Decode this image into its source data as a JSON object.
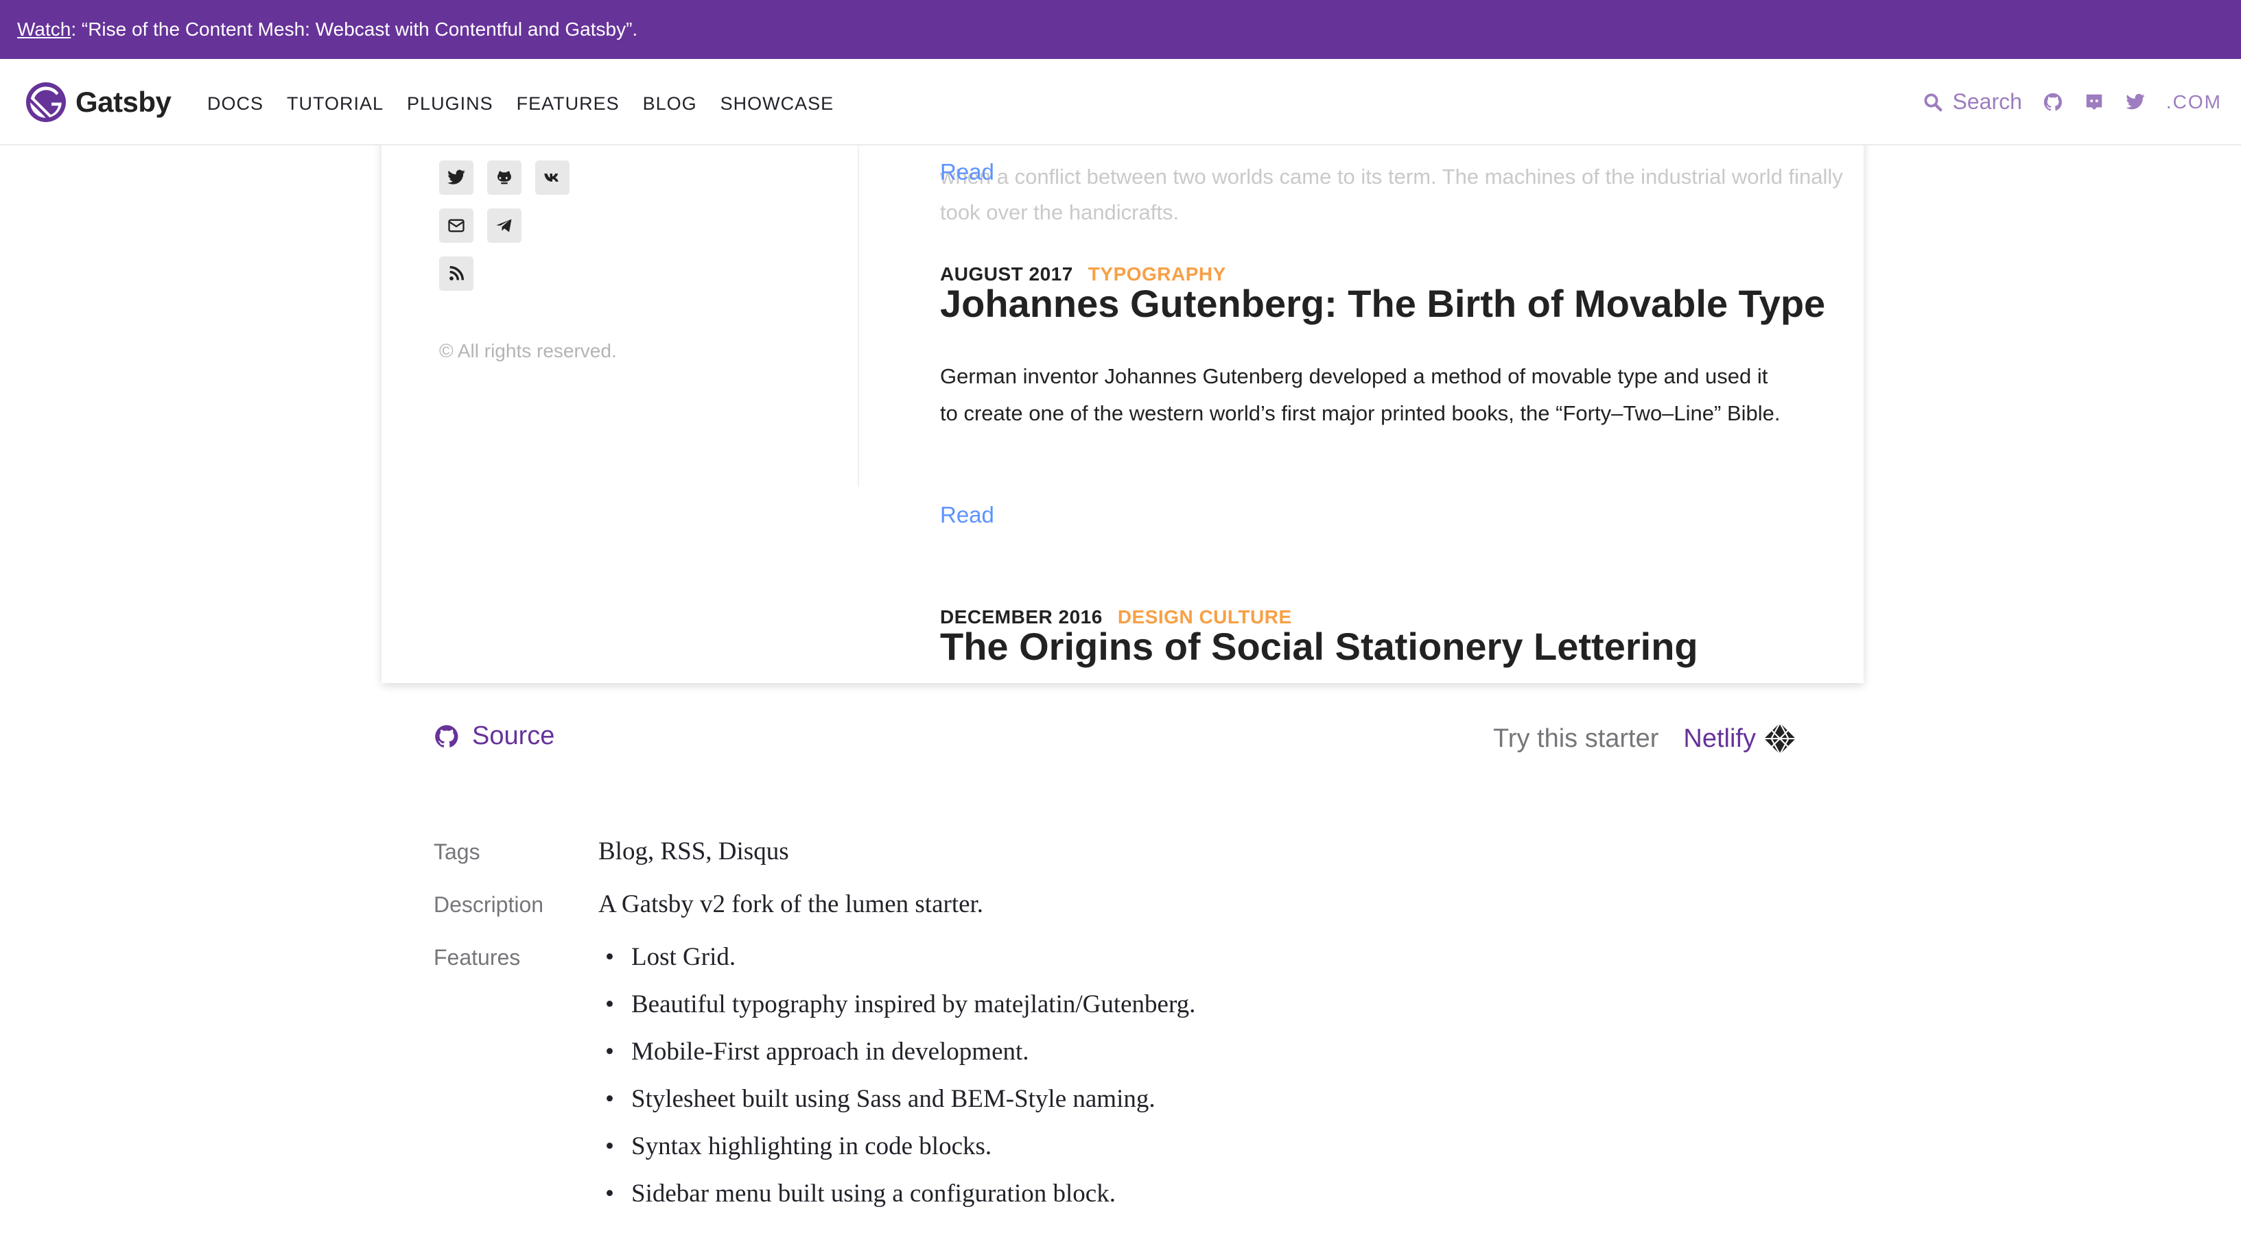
{
  "banner": {
    "link": "Watch",
    "text": ": “Rise of the Content Mesh: Webcast with Contentful and Gatsby”."
  },
  "header": {
    "brand": "Gatsby",
    "nav": [
      "DOCS",
      "TUTORIAL",
      "PLUGINS",
      "FEATURES",
      "BLOG",
      "SHOWCASE"
    ],
    "search_placeholder": "Search",
    "dotcom": ".COM"
  },
  "preview": {
    "faded_text": "when a conflict between two worlds came to its term. The machines of the industrial world finally took over the handicrafts.",
    "copyright": "© All rights reserved.",
    "read_label": "Read",
    "posts": [
      {
        "date": "AUGUST 2017",
        "category": "TYPOGRAPHY",
        "title": "Johannes Gutenberg: The Birth of Movable Type",
        "description": "German inventor Johannes Gutenberg developed a method of movable type and used it to create one of the western world’s first major printed books, the “Forty–Two–Line” Bible."
      },
      {
        "date": "DECEMBER 2016",
        "category": "DESIGN CULTURE",
        "title": "The Origins of Social Stationery Lettering"
      }
    ]
  },
  "source": {
    "label": "Source"
  },
  "try": {
    "label": "Try this starter",
    "netlify": "Netlify"
  },
  "details": {
    "tags_label": "Tags",
    "tags_value": "Blog, RSS, Disqus",
    "description_label": "Description",
    "description_value": "A Gatsby v2 fork of the lumen starter.",
    "features_label": "Features",
    "features": [
      "Lost Grid.",
      "Beautiful typography inspired by matejlatin/Gutenberg.",
      "Mobile-First approach in development.",
      "Stylesheet built using Sass and BEM-Style naming.",
      "Syntax highlighting in code blocks.",
      "Sidebar menu built using a configuration block."
    ]
  },
  "colors": {
    "brand": "#663399",
    "accent": "#f7a046",
    "link": "#5d93ff"
  }
}
